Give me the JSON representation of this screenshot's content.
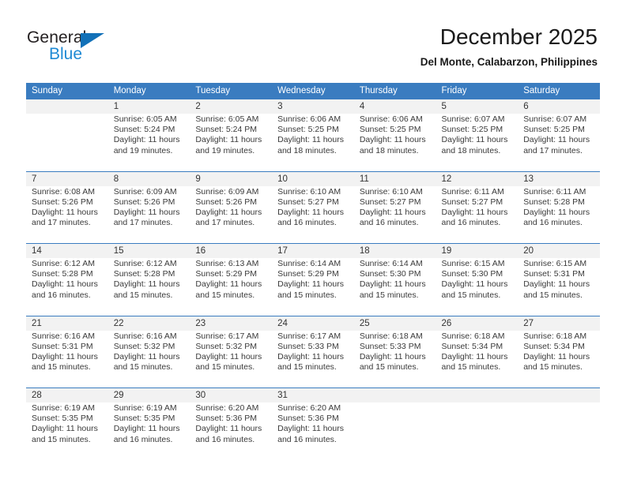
{
  "brand": {
    "name_top": "General",
    "name_bottom": "Blue",
    "triangle_icon": "triangle-icon",
    "color_dark": "#231f20",
    "color_blue": "#1f8ad4"
  },
  "header": {
    "title": "December 2025",
    "subtitle": "Del Monte, Calabarzon, Philippines"
  },
  "theme": {
    "header_row_bg": "#3a7cc0",
    "daynum_bg": "#f2f2f2",
    "cell_bg": "#ffffff",
    "text": "#3a3a3a"
  },
  "weekdays": [
    "Sunday",
    "Monday",
    "Tuesday",
    "Wednesday",
    "Thursday",
    "Friday",
    "Saturday"
  ],
  "weeks": [
    {
      "days": [
        {
          "num": "",
          "sunrise": "",
          "sunset": "",
          "daylight_1": "",
          "daylight_2": "",
          "empty": true
        },
        {
          "num": "1",
          "sunrise": "Sunrise: 6:05 AM",
          "sunset": "Sunset: 5:24 PM",
          "daylight_1": "Daylight: 11 hours",
          "daylight_2": "and 19 minutes."
        },
        {
          "num": "2",
          "sunrise": "Sunrise: 6:05 AM",
          "sunset": "Sunset: 5:24 PM",
          "daylight_1": "Daylight: 11 hours",
          "daylight_2": "and 19 minutes."
        },
        {
          "num": "3",
          "sunrise": "Sunrise: 6:06 AM",
          "sunset": "Sunset: 5:25 PM",
          "daylight_1": "Daylight: 11 hours",
          "daylight_2": "and 18 minutes."
        },
        {
          "num": "4",
          "sunrise": "Sunrise: 6:06 AM",
          "sunset": "Sunset: 5:25 PM",
          "daylight_1": "Daylight: 11 hours",
          "daylight_2": "and 18 minutes."
        },
        {
          "num": "5",
          "sunrise": "Sunrise: 6:07 AM",
          "sunset": "Sunset: 5:25 PM",
          "daylight_1": "Daylight: 11 hours",
          "daylight_2": "and 18 minutes."
        },
        {
          "num": "6",
          "sunrise": "Sunrise: 6:07 AM",
          "sunset": "Sunset: 5:25 PM",
          "daylight_1": "Daylight: 11 hours",
          "daylight_2": "and 17 minutes."
        }
      ]
    },
    {
      "days": [
        {
          "num": "7",
          "sunrise": "Sunrise: 6:08 AM",
          "sunset": "Sunset: 5:26 PM",
          "daylight_1": "Daylight: 11 hours",
          "daylight_2": "and 17 minutes."
        },
        {
          "num": "8",
          "sunrise": "Sunrise: 6:09 AM",
          "sunset": "Sunset: 5:26 PM",
          "daylight_1": "Daylight: 11 hours",
          "daylight_2": "and 17 minutes."
        },
        {
          "num": "9",
          "sunrise": "Sunrise: 6:09 AM",
          "sunset": "Sunset: 5:26 PM",
          "daylight_1": "Daylight: 11 hours",
          "daylight_2": "and 17 minutes."
        },
        {
          "num": "10",
          "sunrise": "Sunrise: 6:10 AM",
          "sunset": "Sunset: 5:27 PM",
          "daylight_1": "Daylight: 11 hours",
          "daylight_2": "and 16 minutes."
        },
        {
          "num": "11",
          "sunrise": "Sunrise: 6:10 AM",
          "sunset": "Sunset: 5:27 PM",
          "daylight_1": "Daylight: 11 hours",
          "daylight_2": "and 16 minutes."
        },
        {
          "num": "12",
          "sunrise": "Sunrise: 6:11 AM",
          "sunset": "Sunset: 5:27 PM",
          "daylight_1": "Daylight: 11 hours",
          "daylight_2": "and 16 minutes."
        },
        {
          "num": "13",
          "sunrise": "Sunrise: 6:11 AM",
          "sunset": "Sunset: 5:28 PM",
          "daylight_1": "Daylight: 11 hours",
          "daylight_2": "and 16 minutes."
        }
      ]
    },
    {
      "days": [
        {
          "num": "14",
          "sunrise": "Sunrise: 6:12 AM",
          "sunset": "Sunset: 5:28 PM",
          "daylight_1": "Daylight: 11 hours",
          "daylight_2": "and 16 minutes."
        },
        {
          "num": "15",
          "sunrise": "Sunrise: 6:12 AM",
          "sunset": "Sunset: 5:28 PM",
          "daylight_1": "Daylight: 11 hours",
          "daylight_2": "and 15 minutes."
        },
        {
          "num": "16",
          "sunrise": "Sunrise: 6:13 AM",
          "sunset": "Sunset: 5:29 PM",
          "daylight_1": "Daylight: 11 hours",
          "daylight_2": "and 15 minutes."
        },
        {
          "num": "17",
          "sunrise": "Sunrise: 6:14 AM",
          "sunset": "Sunset: 5:29 PM",
          "daylight_1": "Daylight: 11 hours",
          "daylight_2": "and 15 minutes."
        },
        {
          "num": "18",
          "sunrise": "Sunrise: 6:14 AM",
          "sunset": "Sunset: 5:30 PM",
          "daylight_1": "Daylight: 11 hours",
          "daylight_2": "and 15 minutes."
        },
        {
          "num": "19",
          "sunrise": "Sunrise: 6:15 AM",
          "sunset": "Sunset: 5:30 PM",
          "daylight_1": "Daylight: 11 hours",
          "daylight_2": "and 15 minutes."
        },
        {
          "num": "20",
          "sunrise": "Sunrise: 6:15 AM",
          "sunset": "Sunset: 5:31 PM",
          "daylight_1": "Daylight: 11 hours",
          "daylight_2": "and 15 minutes."
        }
      ]
    },
    {
      "days": [
        {
          "num": "21",
          "sunrise": "Sunrise: 6:16 AM",
          "sunset": "Sunset: 5:31 PM",
          "daylight_1": "Daylight: 11 hours",
          "daylight_2": "and 15 minutes."
        },
        {
          "num": "22",
          "sunrise": "Sunrise: 6:16 AM",
          "sunset": "Sunset: 5:32 PM",
          "daylight_1": "Daylight: 11 hours",
          "daylight_2": "and 15 minutes."
        },
        {
          "num": "23",
          "sunrise": "Sunrise: 6:17 AM",
          "sunset": "Sunset: 5:32 PM",
          "daylight_1": "Daylight: 11 hours",
          "daylight_2": "and 15 minutes."
        },
        {
          "num": "24",
          "sunrise": "Sunrise: 6:17 AM",
          "sunset": "Sunset: 5:33 PM",
          "daylight_1": "Daylight: 11 hours",
          "daylight_2": "and 15 minutes."
        },
        {
          "num": "25",
          "sunrise": "Sunrise: 6:18 AM",
          "sunset": "Sunset: 5:33 PM",
          "daylight_1": "Daylight: 11 hours",
          "daylight_2": "and 15 minutes."
        },
        {
          "num": "26",
          "sunrise": "Sunrise: 6:18 AM",
          "sunset": "Sunset: 5:34 PM",
          "daylight_1": "Daylight: 11 hours",
          "daylight_2": "and 15 minutes."
        },
        {
          "num": "27",
          "sunrise": "Sunrise: 6:18 AM",
          "sunset": "Sunset: 5:34 PM",
          "daylight_1": "Daylight: 11 hours",
          "daylight_2": "and 15 minutes."
        }
      ]
    },
    {
      "days": [
        {
          "num": "28",
          "sunrise": "Sunrise: 6:19 AM",
          "sunset": "Sunset: 5:35 PM",
          "daylight_1": "Daylight: 11 hours",
          "daylight_2": "and 15 minutes."
        },
        {
          "num": "29",
          "sunrise": "Sunrise: 6:19 AM",
          "sunset": "Sunset: 5:35 PM",
          "daylight_1": "Daylight: 11 hours",
          "daylight_2": "and 16 minutes."
        },
        {
          "num": "30",
          "sunrise": "Sunrise: 6:20 AM",
          "sunset": "Sunset: 5:36 PM",
          "daylight_1": "Daylight: 11 hours",
          "daylight_2": "and 16 minutes."
        },
        {
          "num": "31",
          "sunrise": "Sunrise: 6:20 AM",
          "sunset": "Sunset: 5:36 PM",
          "daylight_1": "Daylight: 11 hours",
          "daylight_2": "and 16 minutes."
        },
        {
          "num": "",
          "sunrise": "",
          "sunset": "",
          "daylight_1": "",
          "daylight_2": "",
          "empty": true
        },
        {
          "num": "",
          "sunrise": "",
          "sunset": "",
          "daylight_1": "",
          "daylight_2": "",
          "empty": true
        },
        {
          "num": "",
          "sunrise": "",
          "sunset": "",
          "daylight_1": "",
          "daylight_2": "",
          "empty": true
        }
      ]
    }
  ]
}
